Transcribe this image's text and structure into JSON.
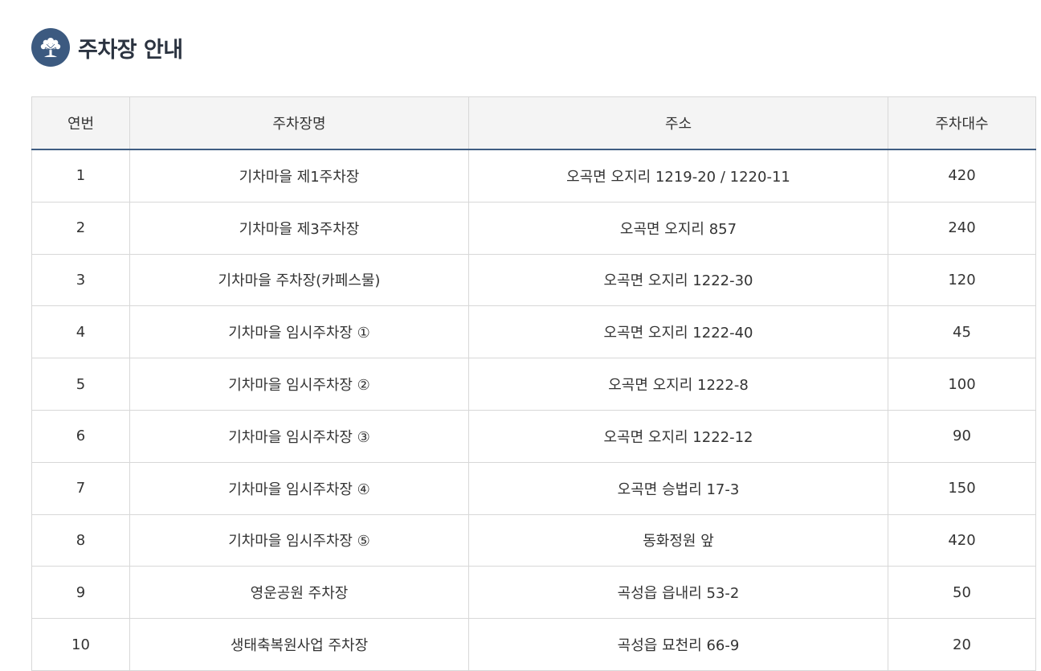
{
  "page": {
    "title": "주차장 안내",
    "logo_icon": "tree-icon",
    "accent_color": "#3c5a80"
  },
  "table": {
    "headers": [
      "연번",
      "주차장명",
      "주소",
      "주차대수"
    ],
    "rows": [
      {
        "no": "1",
        "name": "기차마을 제1주차장",
        "address": "오곡면 오지리 1219-20 / 1220-11",
        "spaces": "420"
      },
      {
        "no": "2",
        "name": "기차마을 제3주차장",
        "address": "오곡면 오지리 857",
        "spaces": "240"
      },
      {
        "no": "3",
        "name": "기차마을 주차장(카페스물)",
        "address": "오곡면 오지리 1222-30",
        "spaces": "120"
      },
      {
        "no": "4",
        "name": "기차마을 임시주차장 ①",
        "address": "오곡면 오지리 1222-40",
        "spaces": "45"
      },
      {
        "no": "5",
        "name": "기차마을 임시주차장 ②",
        "address": "오곡면 오지리 1222-8",
        "spaces": "100"
      },
      {
        "no": "6",
        "name": "기차마을 임시주차장 ③",
        "address": "오곡면 오지리 1222-12",
        "spaces": "90"
      },
      {
        "no": "7",
        "name": "기차마을 임시주차장 ④",
        "address": "오곡면 승법리 17-3",
        "spaces": "150"
      },
      {
        "no": "8",
        "name": "기차마을 임시주차장 ⑤",
        "address": "동화정원 앞",
        "spaces": "420"
      },
      {
        "no": "9",
        "name": "영운공원 주차장",
        "address": "곡성읍 읍내리 53-2",
        "spaces": "50"
      },
      {
        "no": "10",
        "name": "생태축복원사업 주차장",
        "address": "곡성읍 묘천리 66-9",
        "spaces": "20"
      }
    ]
  }
}
